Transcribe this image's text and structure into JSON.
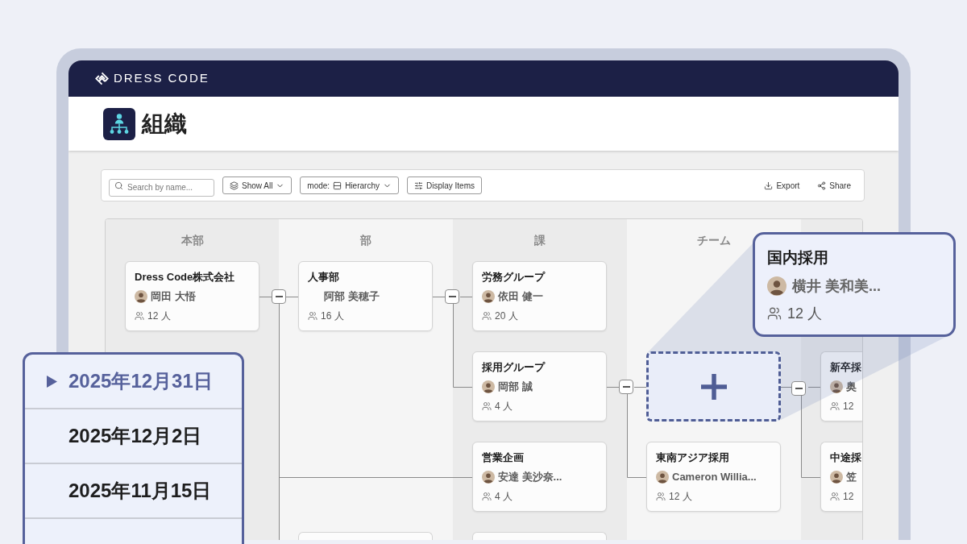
{
  "brand": {
    "name": "DRESS CODE"
  },
  "page": {
    "title": "組織"
  },
  "toolbar": {
    "search": {
      "placeholder": "Search by name..."
    },
    "controls": [
      {
        "kind": "filter",
        "label": "Show All"
      },
      {
        "kind": "mode",
        "prefix": "mode:",
        "label": "Hierarchy"
      },
      {
        "kind": "display",
        "label": "Display Items"
      }
    ],
    "actions": [
      {
        "kind": "export",
        "label": "Export"
      },
      {
        "kind": "share",
        "label": "Share"
      }
    ]
  },
  "org_chart": {
    "columns": [
      {
        "label": "本部",
        "cards": [
          {
            "kind": "unit",
            "title": "Dress Code株式会社",
            "person": "岡田 大悟",
            "avatar": true,
            "count": "12 人",
            "toggle": {
              "expanded": true
            }
          }
        ]
      },
      {
        "label": "部",
        "cards": [
          {
            "kind": "unit",
            "title": "人事部",
            "person": "阿部 美穂子",
            "avatar": false,
            "count": "16 人",
            "toggle": {
              "expanded": true
            }
          },
          {
            "kind": "empty"
          },
          {
            "kind": "empty"
          },
          {
            "kind": "stub"
          }
        ]
      },
      {
        "label": "課",
        "cards": [
          {
            "kind": "unit",
            "title": "労務グループ",
            "person": "依田 健一",
            "avatar": true,
            "count": "20 人"
          },
          {
            "kind": "unit",
            "title": "採用グループ",
            "person": "岡部 誠",
            "avatar": true,
            "count": "4 人",
            "toggle": {
              "expanded": true
            }
          },
          {
            "kind": "unit",
            "title": "営業企画",
            "person": "安達 美沙奈...",
            "avatar": true,
            "count": "4 人"
          },
          {
            "kind": "stub"
          }
        ]
      },
      {
        "label": "チーム",
        "cards": [
          {
            "kind": "empty"
          },
          {
            "kind": "placeholder",
            "toggle": {
              "expanded": true
            }
          },
          {
            "kind": "unit",
            "title": "東南アジア採用",
            "person": "Cameron Willia...",
            "avatar": true,
            "count": "12 人"
          }
        ]
      },
      {
        "cards": [
          {
            "kind": "empty"
          },
          {
            "kind": "unit",
            "title": "新卒採",
            "person": "奥",
            "avatar": true,
            "count": "12"
          },
          {
            "kind": "unit",
            "title": "中途採",
            "person": "笠",
            "avatar": true,
            "count": "12"
          }
        ]
      }
    ]
  },
  "callout": {
    "title": "国内採用",
    "person": "横井 美和美...",
    "avatar": true,
    "count": "12 人"
  },
  "history": {
    "dates": [
      {
        "label": "2025年12月31日",
        "selected": true
      },
      {
        "label": "2025年12月2日",
        "selected": false
      },
      {
        "label": "2025年11月15日",
        "selected": false
      }
    ]
  }
}
